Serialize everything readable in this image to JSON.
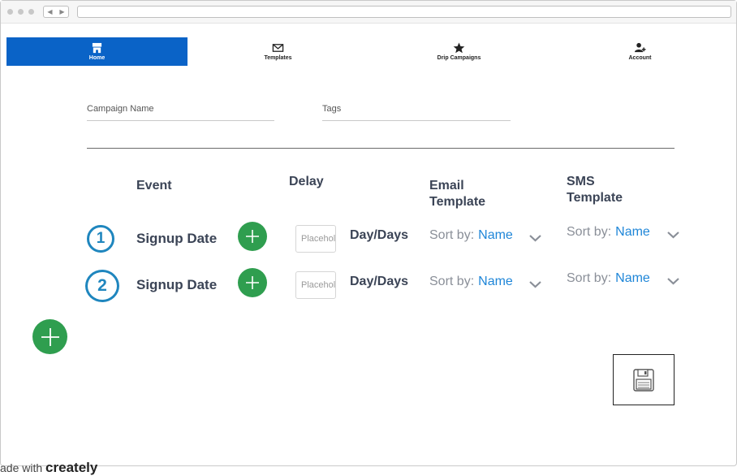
{
  "browser": {
    "back_glyph": "◀",
    "forward_glyph": "▶"
  },
  "nav": [
    {
      "label": "Home",
      "icon": "home-icon",
      "active": true
    },
    {
      "label": "Templates",
      "icon": "envelope-icon",
      "active": false
    },
    {
      "label": "Drip Campaigns",
      "icon": "star-icon",
      "active": false
    },
    {
      "label": "Account",
      "icon": "add-user-icon",
      "active": false
    }
  ],
  "form": {
    "campaign_name_placeholder": "Campaign Name",
    "tags_placeholder": "Tags"
  },
  "columns": {
    "event": "Event",
    "delay": "Delay",
    "email_template_line1": "Email",
    "email_template_line2": "Template",
    "sms_template_line1": "SMS",
    "sms_template_line2": "Template"
  },
  "rows": [
    {
      "step": "1",
      "event": "Signup Date",
      "delay_placeholder": "Placeholder",
      "unit": "Day/Days",
      "email_sort_label": "Sort by:",
      "email_sort_value": "Name",
      "sms_sort_label": "Sort by:",
      "sms_sort_value": "Name"
    },
    {
      "step": "2",
      "event": "Signup Date",
      "delay_placeholder": "Placeholder",
      "unit": "Day/Days",
      "email_sort_label": "Sort by:",
      "email_sort_value": "Name",
      "sms_sort_label": "Sort by:",
      "sms_sort_value": "Name"
    }
  ],
  "footer": {
    "prefix": "ade with",
    "brand": "creately"
  },
  "colors": {
    "accent": "#0a63c7",
    "add_green": "#2f9e4f",
    "step_blue": "#1f86be",
    "link_blue": "#1f86d8"
  }
}
